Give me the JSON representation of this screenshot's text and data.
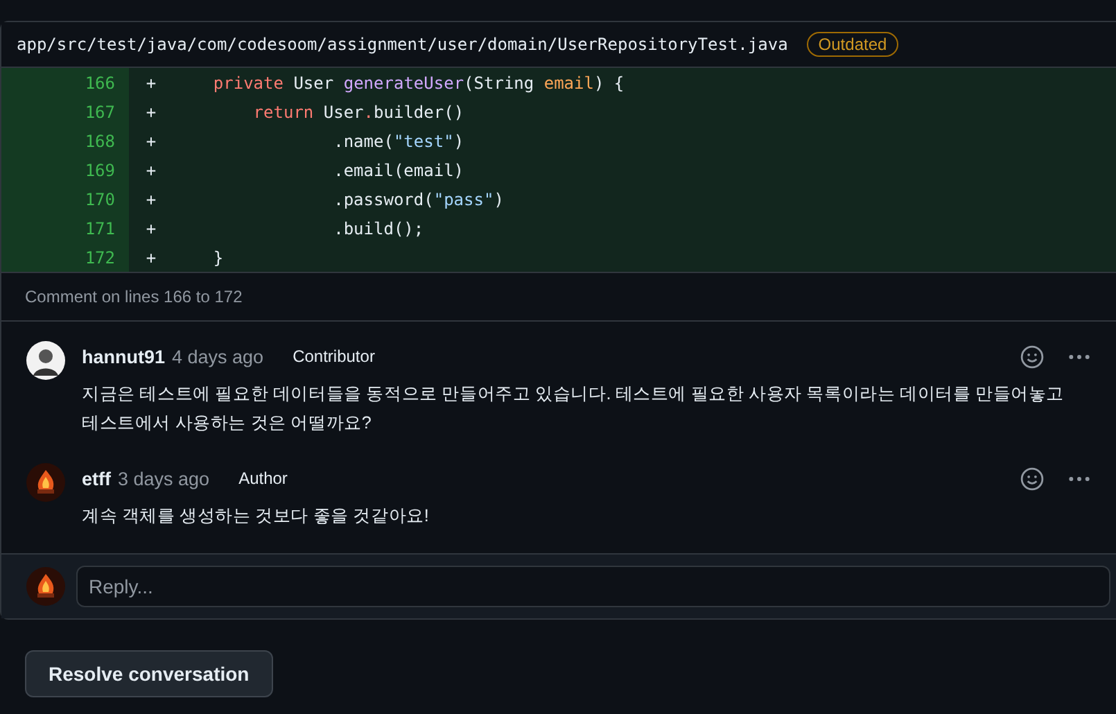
{
  "file": {
    "path": "app/src/test/java/com/codesoom/assignment/user/domain/UserRepositoryTest.java",
    "badge": "Outdated"
  },
  "diff_lines": [
    {
      "number": "166",
      "sign": "+",
      "tokens": [
        {
          "kind": "keyword",
          "text": "    private"
        },
        {
          "kind": "plain",
          "text": " User "
        },
        {
          "kind": "function",
          "text": "generateUser"
        },
        {
          "kind": "plain",
          "text": "(String "
        },
        {
          "kind": "parameter",
          "text": "email"
        },
        {
          "kind": "plain",
          "text": ") {"
        }
      ]
    },
    {
      "number": "167",
      "sign": "+",
      "tokens": [
        {
          "kind": "keyword",
          "text": "        return"
        },
        {
          "kind": "plain",
          "text": " User"
        },
        {
          "kind": "keyword",
          "text": "."
        },
        {
          "kind": "plain",
          "text": "builder()"
        }
      ]
    },
    {
      "number": "168",
      "sign": "+",
      "tokens": [
        {
          "kind": "plain",
          "text": "                .name("
        },
        {
          "kind": "string",
          "text": "\"test\""
        },
        {
          "kind": "plain",
          "text": ")"
        }
      ]
    },
    {
      "number": "169",
      "sign": "+",
      "tokens": [
        {
          "kind": "plain",
          "text": "                .email(email)"
        }
      ]
    },
    {
      "number": "170",
      "sign": "+",
      "tokens": [
        {
          "kind": "plain",
          "text": "                .password("
        },
        {
          "kind": "string",
          "text": "\"pass\""
        },
        {
          "kind": "plain",
          "text": ")"
        }
      ]
    },
    {
      "number": "171",
      "sign": "+",
      "tokens": [
        {
          "kind": "plain",
          "text": "                .build();"
        }
      ]
    },
    {
      "number": "172",
      "sign": "+",
      "tokens": [
        {
          "kind": "plain",
          "text": "    }"
        }
      ]
    }
  ],
  "caption": "Comment on lines 166 to 172",
  "comments": [
    {
      "author": "hannut91",
      "time": "4 days ago",
      "role": "Contributor",
      "kind": "person",
      "body": "지금은 테스트에 필요한 데이터들을 동적으로 만들어주고 있습니다. 테스트에 필요한 사용자 목록이라는 데이터를 만들어놓고 테스트에서 사용하는 것은 어떨까요?"
    },
    {
      "author": "etff",
      "time": "3 days ago",
      "role": "Author",
      "kind": "fire",
      "body": "계속 객체를 생성하는 것보다 좋을 것같아요!"
    }
  ],
  "reply": {
    "placeholder": "Reply..."
  },
  "resolve_button": "Resolve conversation"
}
